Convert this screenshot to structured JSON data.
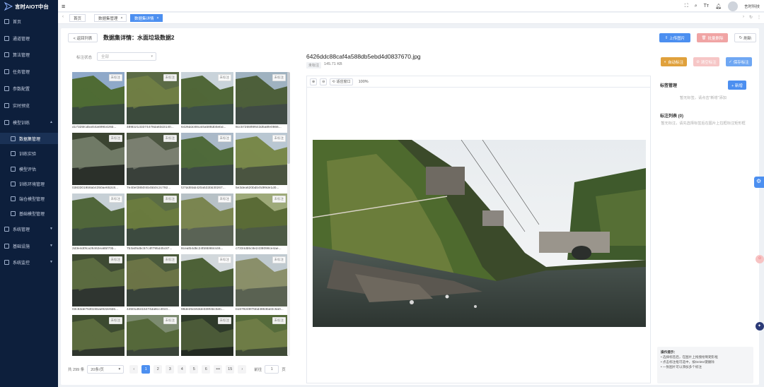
{
  "app": {
    "title": "言时AIOT中台"
  },
  "sidebar": {
    "items": [
      {
        "label": "首页",
        "icon": "home-icon"
      },
      {
        "label": "通道管理",
        "icon": "channel-icon"
      },
      {
        "label": "算法管理",
        "icon": "algorithm-icon"
      },
      {
        "label": "任务管理",
        "icon": "task-icon"
      },
      {
        "label": "参数配置",
        "icon": "settings-icon"
      },
      {
        "label": "实时预览",
        "icon": "preview-icon"
      },
      {
        "label": "模型训练",
        "icon": "training-icon"
      },
      {
        "label": "数据集管理",
        "icon": "dataset-icon"
      },
      {
        "label": "训练实验",
        "icon": "experiment-icon"
      },
      {
        "label": "模型评估",
        "icon": "evaluate-icon"
      },
      {
        "label": "训练环境管理",
        "icon": "env-icon"
      },
      {
        "label": "端仓模型管理",
        "icon": "edge-model-icon"
      },
      {
        "label": "基础模型管理",
        "icon": "base-model-icon"
      },
      {
        "label": "系统管理",
        "icon": "system-icon"
      },
      {
        "label": "基础设施",
        "icon": "infra-icon"
      },
      {
        "label": "系统监控",
        "icon": "monitor-icon"
      }
    ]
  },
  "topbar": {
    "user": "言时科技",
    "font_icon": "Tт"
  },
  "tabs": [
    {
      "label": "首页"
    },
    {
      "label": "数据集管理"
    },
    {
      "label": "数据集详情"
    }
  ],
  "header": {
    "back_label": "< 返回列表",
    "title": "数据集详情：水面垃圾数据2",
    "upload_label": "上传图片",
    "batch_delete_label": "批量删除",
    "refresh_label": "刷新"
  },
  "filter": {
    "label": "标注状态",
    "placeholder": "全部"
  },
  "images": [
    {
      "name": "d17325fcdbaf44a699b426b...",
      "badge": "未标注"
    },
    {
      "name": "489b1f133374478da83d3140...",
      "badge": "未标注"
    },
    {
      "name": "6426ddc88caf4a588db5ebd...",
      "badge": "未标注"
    },
    {
      "name": "8cc57255ff8f643d5a8fe0866...",
      "badge": "未标注"
    },
    {
      "name": "03833019b8ab4350ae652c8...",
      "badge": "未标注"
    },
    {
      "name": "7e40ef3850f4b45b0c2c792...",
      "badge": "未标注"
    },
    {
      "name": "f27dd5fab420a532bb30267...",
      "badge": "未标注"
    },
    {
      "name": "5e3dea620bdb4fd99de1d0...",
      "badge": "未标注"
    },
    {
      "name": "2d3e4d0fca26462ea65f70b...",
      "badge": "未标注"
    },
    {
      "name": "7b3a05dbc57c4ff795d45c87...",
      "badge": "未标注"
    },
    {
      "name": "8ceafb4d5c24fb9b984446...",
      "badge": "未标注"
    },
    {
      "name": "c7334db5c8e2438098ce4ae...",
      "badge": "未标注"
    },
    {
      "name": "03c63de753024bae922e5b6...",
      "badge": "未标注"
    },
    {
      "name": "44501d6415474da8cc40c0...",
      "badge": "未标注"
    },
    {
      "name": "98de25cb53de338f4bc5eb...",
      "badge": "未标注"
    },
    {
      "name": "b1679249f7bbd4863baf2c6a0...",
      "badge": "未标注"
    },
    {
      "name": "",
      "badge": "未标注"
    },
    {
      "name": "",
      "badge": "未标注"
    },
    {
      "name": "",
      "badge": "未标注"
    },
    {
      "name": "",
      "badge": "未标注"
    }
  ],
  "pagination": {
    "total": "共 299 条",
    "page_size": "20条/页",
    "pages": [
      "1",
      "2",
      "3",
      "4",
      "5",
      "6",
      "•••",
      "15"
    ],
    "current": "1",
    "goto_label": "前往",
    "goto_value": "1",
    "page_suffix": "页"
  },
  "viewer": {
    "filename": "6426ddc88caf4a588db5ebd4d0837670.jpg",
    "status": "未标注",
    "size": "145.71 KB",
    "fit_label": "适应窗口",
    "zoom": "100%"
  },
  "actions": {
    "auto_label": "自动标注",
    "clear_label": "清空标注",
    "save_label": "保存标注"
  },
  "label_mgmt": {
    "title": "标签管理",
    "add_label": "+ 新增",
    "empty": "暂无标签，请点击\"新增\"添加"
  },
  "annotation_list": {
    "title": "标注列表 (0)",
    "empty": "暂无标注，请先选择标签后在图片上拉框标注矩形框"
  },
  "tips": {
    "title": "操作提示：",
    "items": [
      "选择标签后，在图片上拖拽绘制矩形框",
      "点击标注框可选中，按Delete键删除",
      "一张图片可以添加多个标注"
    ]
  }
}
